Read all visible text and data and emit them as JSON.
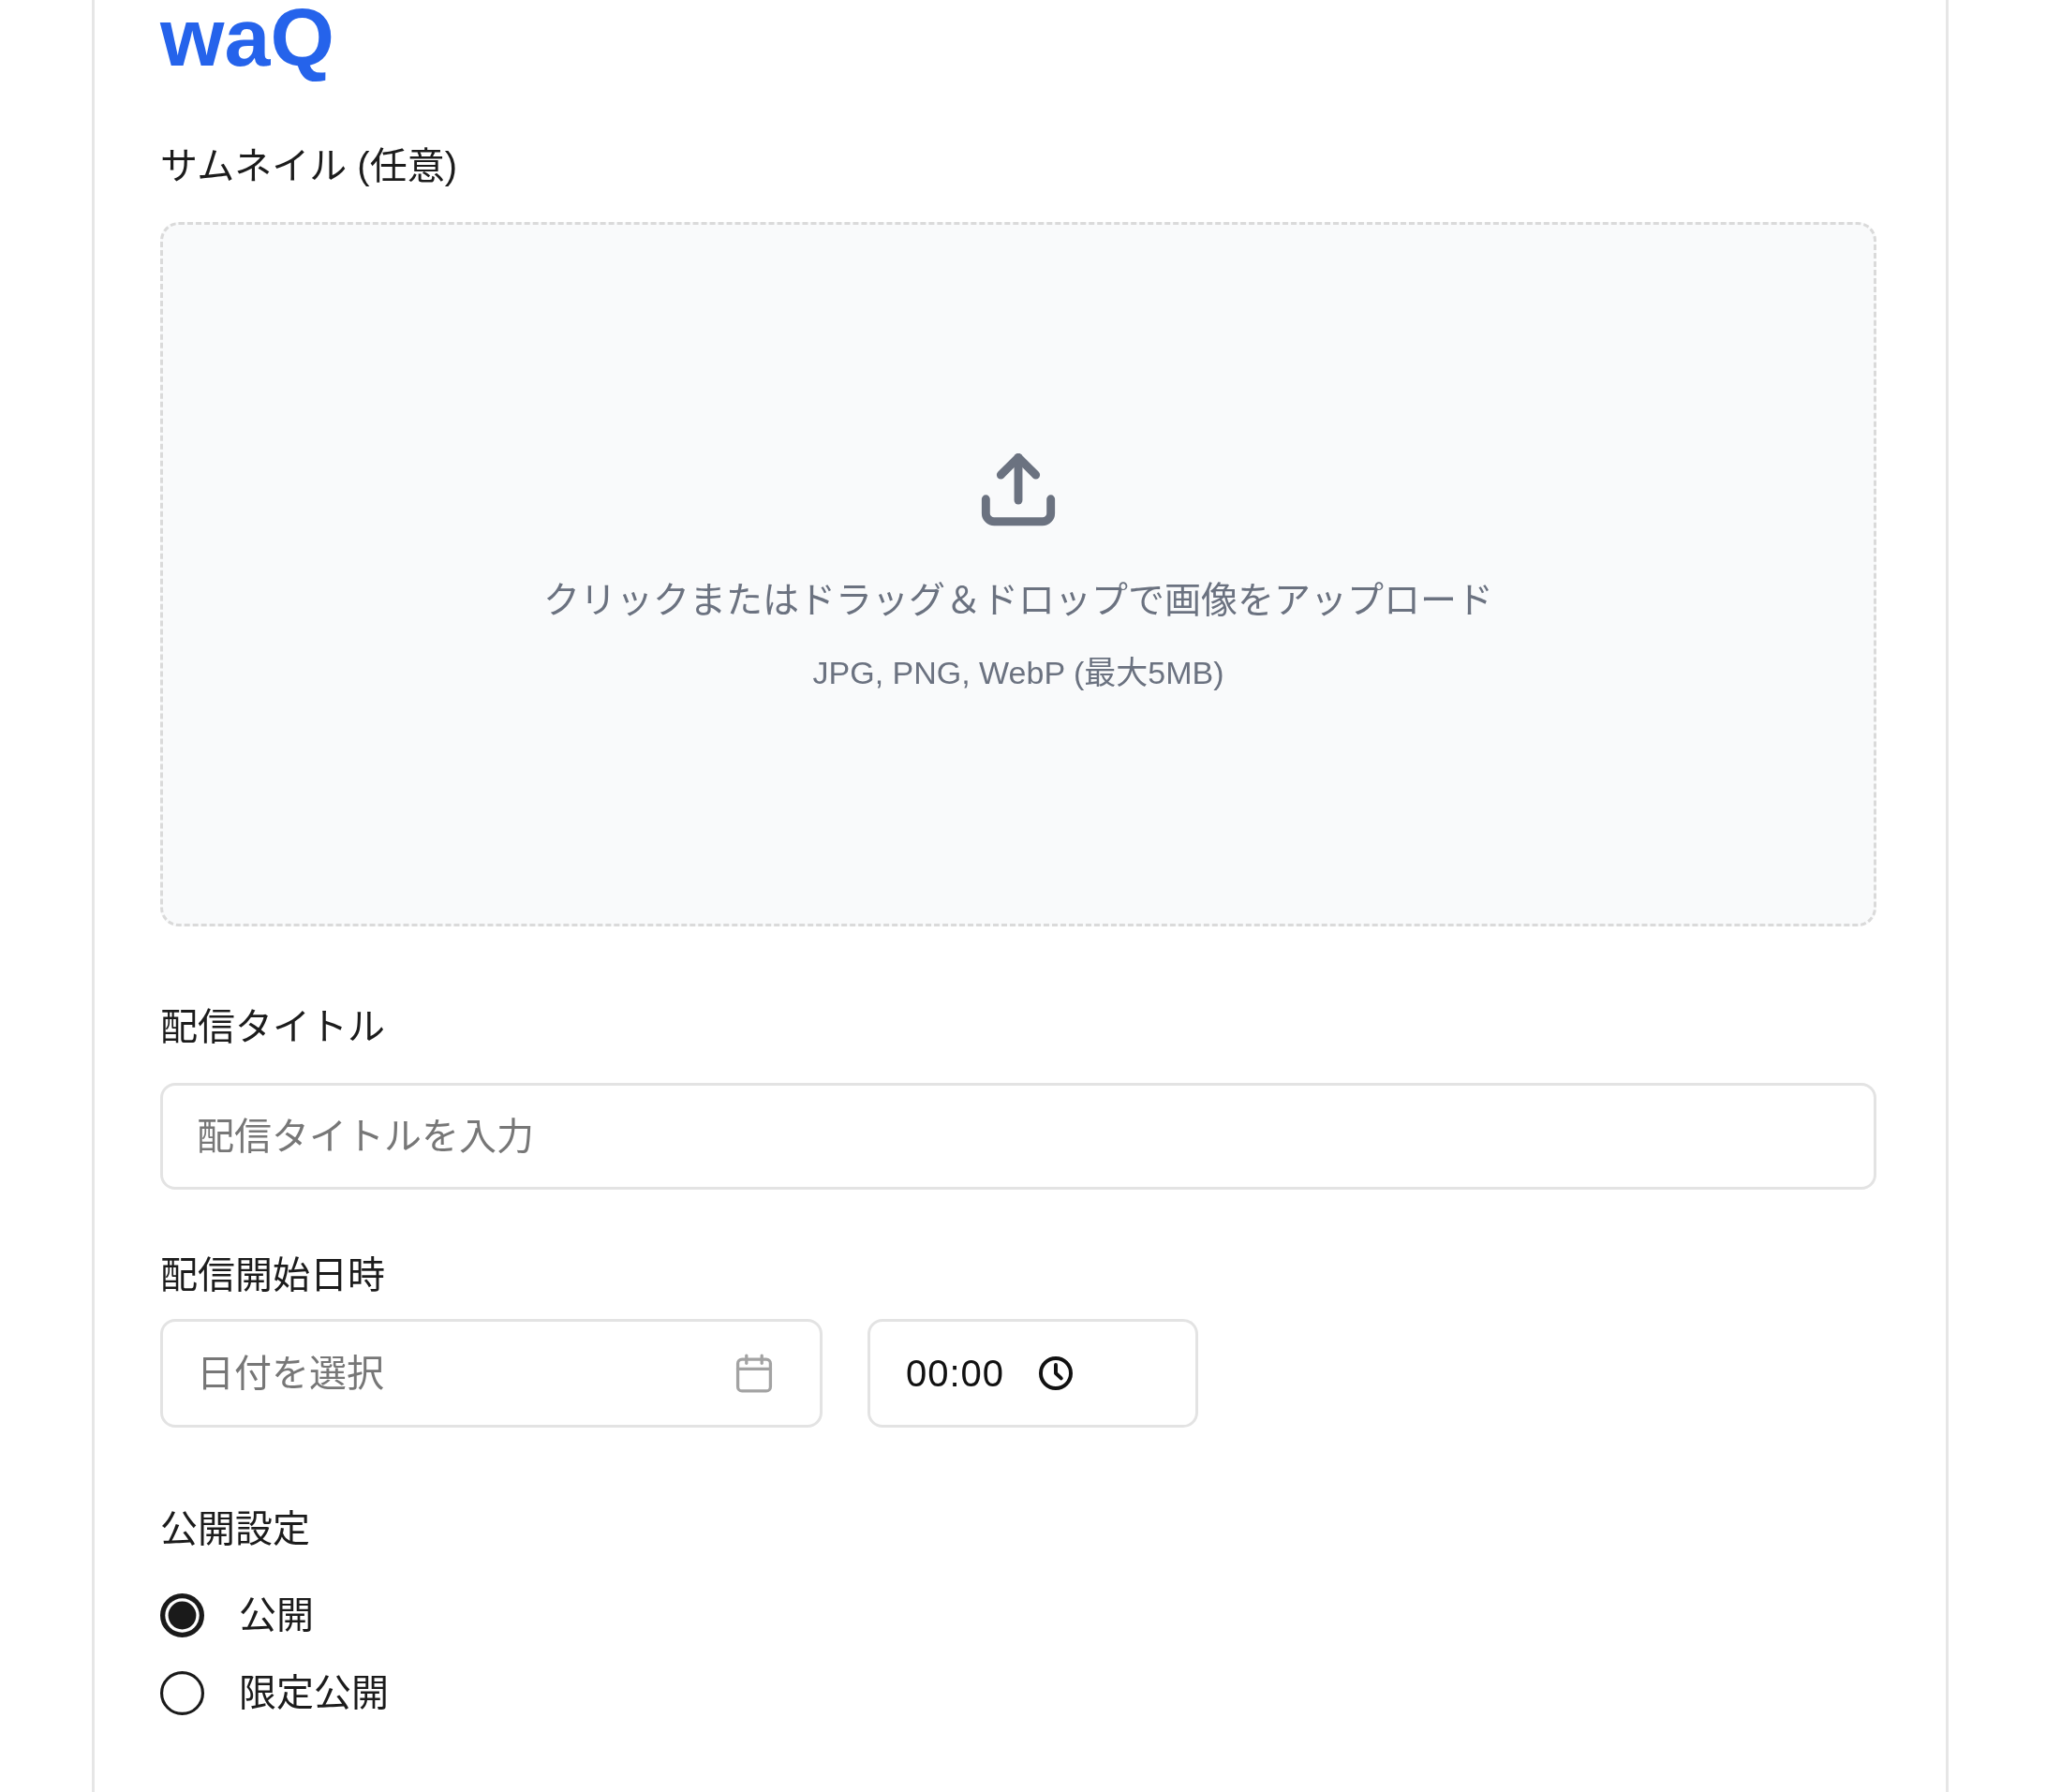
{
  "logo": {
    "text": "waQ"
  },
  "thumbnail": {
    "label": "サムネイル (任意)",
    "dropzone": {
      "instruction": "クリックまたはドラッグ＆ドロップで画像をアップロード",
      "formats": "JPG, PNG, WebP (最大5MB)"
    }
  },
  "title_field": {
    "label": "配信タイトル",
    "placeholder": "配信タイトルを入力"
  },
  "schedule": {
    "label": "配信開始日時",
    "date": {
      "placeholder": "日付を選択"
    },
    "time": {
      "value": "00:00"
    }
  },
  "visibility": {
    "label": "公開設定",
    "options": [
      {
        "label": "公開",
        "selected": true
      },
      {
        "label": "限定公開",
        "selected": false
      }
    ]
  }
}
